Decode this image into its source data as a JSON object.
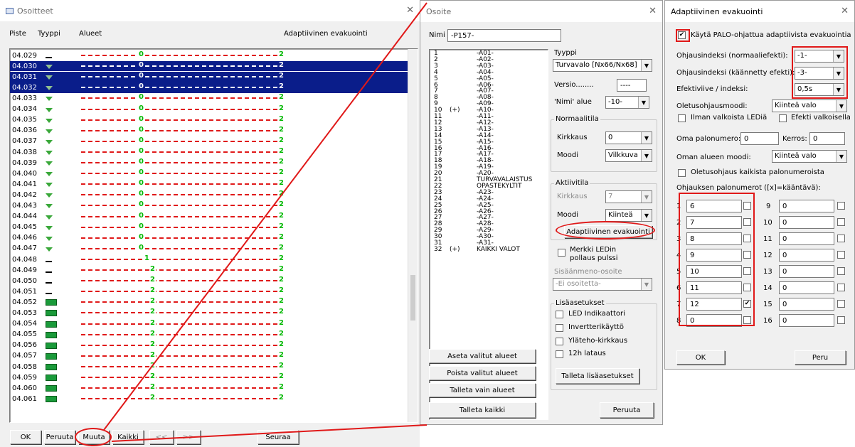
{
  "w1": {
    "title": "Osoitteet",
    "headers": [
      "Piste",
      "Tyyppi",
      "Alueet",
      "Adaptiivinen evakuointi"
    ],
    "rows": [
      {
        "id": "04.029",
        "t": "dash",
        "a": "0",
        "s": 0
      },
      {
        "id": "04.030",
        "t": "lamp",
        "a": "0",
        "s": 1
      },
      {
        "id": "04.031",
        "t": "lamp",
        "a": "0",
        "s": 1
      },
      {
        "id": "04.032",
        "t": "lamp",
        "a": "0",
        "s": 1
      },
      {
        "id": "04.033",
        "t": "lamp",
        "a": "0",
        "s": 0
      },
      {
        "id": "04.034",
        "t": "lamp",
        "a": "0",
        "s": 0
      },
      {
        "id": "04.035",
        "t": "lamp",
        "a": "0",
        "s": 0
      },
      {
        "id": "04.036",
        "t": "lamp",
        "a": "0",
        "s": 0
      },
      {
        "id": "04.037",
        "t": "lamp",
        "a": "0",
        "s": 0
      },
      {
        "id": "04.038",
        "t": "lamp",
        "a": "0",
        "s": 0
      },
      {
        "id": "04.039",
        "t": "lamp",
        "a": "0",
        "s": 0
      },
      {
        "id": "04.040",
        "t": "lamp",
        "a": "0",
        "s": 0
      },
      {
        "id": "04.041",
        "t": "lamp",
        "a": "0",
        "s": 0
      },
      {
        "id": "04.042",
        "t": "lamp",
        "a": "0",
        "s": 0
      },
      {
        "id": "04.043",
        "t": "lamp",
        "a": "0",
        "s": 0
      },
      {
        "id": "04.044",
        "t": "lamp",
        "a": "0",
        "s": 0
      },
      {
        "id": "04.045",
        "t": "lamp",
        "a": "0",
        "s": 0
      },
      {
        "id": "04.046",
        "t": "lamp",
        "a": "0",
        "s": 0
      },
      {
        "id": "04.047",
        "t": "lamp",
        "a": "0",
        "s": 0
      },
      {
        "id": "04.048",
        "t": "dash",
        "a": "1",
        "s": 0
      },
      {
        "id": "04.049",
        "t": "dash",
        "a": "2",
        "s": 0
      },
      {
        "id": "04.050",
        "t": "dash",
        "a": "2",
        "s": 0
      },
      {
        "id": "04.051",
        "t": "dash",
        "a": "2",
        "s": 0
      },
      {
        "id": "04.052",
        "t": "sign",
        "a": "2",
        "s": 0
      },
      {
        "id": "04.053",
        "t": "sign",
        "a": "2",
        "s": 0
      },
      {
        "id": "04.054",
        "t": "sign",
        "a": "2",
        "s": 0
      },
      {
        "id": "04.055",
        "t": "sign",
        "a": "2",
        "s": 0
      },
      {
        "id": "04.056",
        "t": "sign",
        "a": "2",
        "s": 0
      },
      {
        "id": "04.057",
        "t": "sign",
        "a": "2",
        "s": 0
      },
      {
        "id": "04.058",
        "t": "sign",
        "a": "2",
        "s": 0
      },
      {
        "id": "04.059",
        "t": "sign",
        "a": "2",
        "s": 0
      },
      {
        "id": "04.060",
        "t": "sign",
        "a": "2",
        "s": 0
      },
      {
        "id": "04.061",
        "t": "sign",
        "a": "2",
        "s": 0
      }
    ],
    "evac": "2",
    "buttons": {
      "ok": "OK",
      "cancel": "Peruuta",
      "edit": "Muuta",
      "all": "Kaikki",
      "prev": "<<",
      "next": ">>",
      "follow": "Seuraa"
    }
  },
  "w2": {
    "title": "Osoite",
    "name_label": "Nimi",
    "name_value": "-P157-",
    "areas": [
      {
        "n": "1",
        "f": "",
        "l": "-A01-"
      },
      {
        "n": "2",
        "f": "",
        "l": "-A02-"
      },
      {
        "n": "3",
        "f": "",
        "l": "-A03-"
      },
      {
        "n": "4",
        "f": "",
        "l": "-A04-"
      },
      {
        "n": "5",
        "f": "",
        "l": "-A05-"
      },
      {
        "n": "6",
        "f": "",
        "l": "-A06-"
      },
      {
        "n": "7",
        "f": "",
        "l": "-A07-"
      },
      {
        "n": "8",
        "f": "",
        "l": "-A08-"
      },
      {
        "n": "9",
        "f": "",
        "l": "-A09-"
      },
      {
        "n": "10",
        "f": "(+)",
        "l": "-A10-"
      },
      {
        "n": "11",
        "f": "",
        "l": "-A11-"
      },
      {
        "n": "12",
        "f": "",
        "l": "-A12-"
      },
      {
        "n": "13",
        "f": "",
        "l": "-A13-"
      },
      {
        "n": "14",
        "f": "",
        "l": "-A14-"
      },
      {
        "n": "15",
        "f": "",
        "l": "-A15-"
      },
      {
        "n": "16",
        "f": "",
        "l": "-A16-"
      },
      {
        "n": "17",
        "f": "",
        "l": "-A17-"
      },
      {
        "n": "18",
        "f": "",
        "l": "-A18-"
      },
      {
        "n": "19",
        "f": "",
        "l": "-A19-"
      },
      {
        "n": "20",
        "f": "",
        "l": "-A20-"
      },
      {
        "n": "21",
        "f": "",
        "l": "TURVAVALAISTUS"
      },
      {
        "n": "22",
        "f": "",
        "l": "OPASTEKYLTIT"
      },
      {
        "n": "23",
        "f": "",
        "l": "-A23-"
      },
      {
        "n": "24",
        "f": "",
        "l": "-A24-"
      },
      {
        "n": "25",
        "f": "",
        "l": "-A25-"
      },
      {
        "n": "26",
        "f": "",
        "l": "-A26-"
      },
      {
        "n": "27",
        "f": "",
        "l": "-A27-"
      },
      {
        "n": "28",
        "f": "",
        "l": "-A28-"
      },
      {
        "n": "29",
        "f": "",
        "l": "-A29-"
      },
      {
        "n": "30",
        "f": "",
        "l": "-A30-"
      },
      {
        "n": "31",
        "f": "",
        "l": "-A31-"
      },
      {
        "n": "32",
        "f": "(+)",
        "l": "KAIKKI VALOT"
      }
    ],
    "type_label": "Tyyppi",
    "type_value": "Turvavalo [Nx66/Nx68]",
    "version_label": "Versio........",
    "version_value": "----",
    "name_area_label": "'Nimi' alue",
    "name_area_value": "-10-",
    "normal": {
      "label": "Normaalitila",
      "brightness_label": "Kirkkaus",
      "brightness_value": "0",
      "mode_label": "Moodi",
      "mode_value": "Vilkkuva"
    },
    "active": {
      "label": "Aktiivitila",
      "brightness_label": "Kirkkaus",
      "brightness_value": "7",
      "mode_label": "Moodi",
      "mode_value": "Kiinteä"
    },
    "adaptive_btn": "Adaptiivinen evakuointi",
    "led_poll": "Merkki LEDin pollaus pulssi",
    "input_addr_label": "Sisäänmeno-osoite",
    "input_addr_value": "-Ei osoitetta-",
    "extra": {
      "label": "Lisäasetukset",
      "led": "LED Indikaattori",
      "inverter": "Invertterikäyttö",
      "high": "Yläteho-kirkkaus",
      "h12": "12h lataus",
      "save": "Talleta lisäasetukset"
    },
    "buttons": {
      "set": "Aseta valitut alueet",
      "remove": "Poista valitut alueet",
      "save_areas": "Talleta vain alueet",
      "save_all": "Talleta kaikki",
      "cancel": "Peruuta"
    }
  },
  "w3": {
    "title": "Adaptiivinen evakuointi",
    "enable": "Käytä PALO-ohjattua adaptiivista evakuointia",
    "ctl_normal_label": "Ohjausindeksi (normaaliefekti):",
    "ctl_normal_value": "-1-",
    "ctl_rev_label": "Ohjausindeksi (käännetty efekti):",
    "ctl_rev_value": "-3-",
    "delay_label": "Efektiviive / indeksi:",
    "delay_value": "0,5s",
    "default_mode_label": "Oletusohjausmoodi:",
    "default_mode_value": "Kiinteä valo",
    "no_white": "Ilman valkoista LEDiä",
    "effect_white": "Efekti valkoisella",
    "fire_no_label": "Oma palonumero:",
    "fire_no_value": "0",
    "floor_label": "Kerros:",
    "floor_value": "0",
    "area_mode_label": "Oman alueen moodi:",
    "area_mode_value": "Kiinteä valo",
    "default_all": "Oletusohjaus kaikista palonumeroista",
    "fire_list_label": "Ohjauksen palonumerot ([x]=kääntävä):",
    "left": [
      {
        "i": "1",
        "v": "6",
        "c": false
      },
      {
        "i": "2",
        "v": "7",
        "c": false
      },
      {
        "i": "3",
        "v": "8",
        "c": false
      },
      {
        "i": "4",
        "v": "9",
        "c": false
      },
      {
        "i": "5",
        "v": "10",
        "c": false
      },
      {
        "i": "6",
        "v": "11",
        "c": false
      },
      {
        "i": "7",
        "v": "12",
        "c": true
      },
      {
        "i": "8",
        "v": "0",
        "c": false
      }
    ],
    "right": [
      {
        "i": "9",
        "v": "0"
      },
      {
        "i": "10",
        "v": "0"
      },
      {
        "i": "11",
        "v": "0"
      },
      {
        "i": "12",
        "v": "0"
      },
      {
        "i": "13",
        "v": "0"
      },
      {
        "i": "14",
        "v": "0"
      },
      {
        "i": "15",
        "v": "0"
      },
      {
        "i": "16",
        "v": "0"
      }
    ],
    "ok": "OK",
    "cancel": "Peru"
  },
  "colors": {
    "selection": "#0a1d8a",
    "annot": "#e01919",
    "green": "#00b800"
  }
}
